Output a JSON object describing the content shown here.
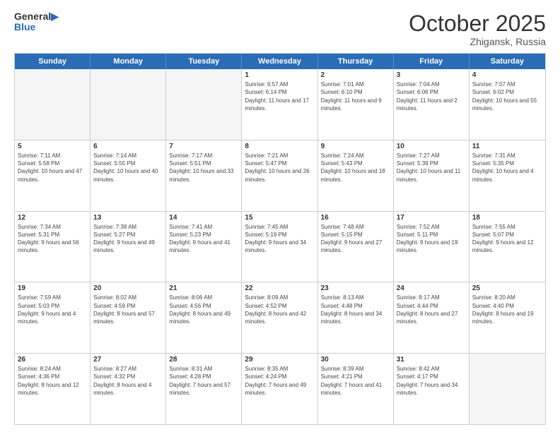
{
  "header": {
    "logo_line1": "General",
    "logo_line2": "Blue",
    "month": "October 2025",
    "location": "Zhigansk, Russia"
  },
  "days": [
    "Sunday",
    "Monday",
    "Tuesday",
    "Wednesday",
    "Thursday",
    "Friday",
    "Saturday"
  ],
  "rows": [
    [
      {
        "date": "",
        "empty": true
      },
      {
        "date": "",
        "empty": true
      },
      {
        "date": "",
        "empty": true
      },
      {
        "date": "1",
        "sunrise": "6:57 AM",
        "sunset": "6:14 PM",
        "daylight": "11 hours and 17 minutes."
      },
      {
        "date": "2",
        "sunrise": "7:01 AM",
        "sunset": "6:10 PM",
        "daylight": "11 hours and 9 minutes."
      },
      {
        "date": "3",
        "sunrise": "7:04 AM",
        "sunset": "6:06 PM",
        "daylight": "11 hours and 2 minutes."
      },
      {
        "date": "4",
        "sunrise": "7:07 AM",
        "sunset": "6:02 PM",
        "daylight": "10 hours and 55 minutes."
      }
    ],
    [
      {
        "date": "5",
        "sunrise": "7:11 AM",
        "sunset": "5:58 PM",
        "daylight": "10 hours and 47 minutes."
      },
      {
        "date": "6",
        "sunrise": "7:14 AM",
        "sunset": "5:55 PM",
        "daylight": "10 hours and 40 minutes."
      },
      {
        "date": "7",
        "sunrise": "7:17 AM",
        "sunset": "5:51 PM",
        "daylight": "10 hours and 33 minutes."
      },
      {
        "date": "8",
        "sunrise": "7:21 AM",
        "sunset": "5:47 PM",
        "daylight": "10 hours and 26 minutes."
      },
      {
        "date": "9",
        "sunrise": "7:24 AM",
        "sunset": "5:43 PM",
        "daylight": "10 hours and 18 minutes."
      },
      {
        "date": "10",
        "sunrise": "7:27 AM",
        "sunset": "5:39 PM",
        "daylight": "10 hours and 11 minutes."
      },
      {
        "date": "11",
        "sunrise": "7:31 AM",
        "sunset": "5:35 PM",
        "daylight": "10 hours and 4 minutes."
      }
    ],
    [
      {
        "date": "12",
        "sunrise": "7:34 AM",
        "sunset": "5:31 PM",
        "daylight": "9 hours and 56 minutes."
      },
      {
        "date": "13",
        "sunrise": "7:38 AM",
        "sunset": "5:27 PM",
        "daylight": "9 hours and 49 minutes."
      },
      {
        "date": "14",
        "sunrise": "7:41 AM",
        "sunset": "5:23 PM",
        "daylight": "9 hours and 41 minutes."
      },
      {
        "date": "15",
        "sunrise": "7:45 AM",
        "sunset": "5:19 PM",
        "daylight": "9 hours and 34 minutes."
      },
      {
        "date": "16",
        "sunrise": "7:48 AM",
        "sunset": "5:15 PM",
        "daylight": "9 hours and 27 minutes."
      },
      {
        "date": "17",
        "sunrise": "7:52 AM",
        "sunset": "5:11 PM",
        "daylight": "9 hours and 19 minutes."
      },
      {
        "date": "18",
        "sunrise": "7:55 AM",
        "sunset": "5:07 PM",
        "daylight": "9 hours and 12 minutes."
      }
    ],
    [
      {
        "date": "19",
        "sunrise": "7:59 AM",
        "sunset": "5:03 PM",
        "daylight": "9 hours and 4 minutes."
      },
      {
        "date": "20",
        "sunrise": "8:02 AM",
        "sunset": "4:59 PM",
        "daylight": "8 hours and 57 minutes."
      },
      {
        "date": "21",
        "sunrise": "8:06 AM",
        "sunset": "4:56 PM",
        "daylight": "8 hours and 49 minutes."
      },
      {
        "date": "22",
        "sunrise": "8:09 AM",
        "sunset": "4:52 PM",
        "daylight": "8 hours and 42 minutes."
      },
      {
        "date": "23",
        "sunrise": "8:13 AM",
        "sunset": "4:48 PM",
        "daylight": "8 hours and 34 minutes."
      },
      {
        "date": "24",
        "sunrise": "8:17 AM",
        "sunset": "4:44 PM",
        "daylight": "8 hours and 27 minutes."
      },
      {
        "date": "25",
        "sunrise": "8:20 AM",
        "sunset": "4:40 PM",
        "daylight": "8 hours and 19 minutes."
      }
    ],
    [
      {
        "date": "26",
        "sunrise": "8:24 AM",
        "sunset": "4:36 PM",
        "daylight": "8 hours and 12 minutes."
      },
      {
        "date": "27",
        "sunrise": "8:27 AM",
        "sunset": "4:32 PM",
        "daylight": "8 hours and 4 minutes."
      },
      {
        "date": "28",
        "sunrise": "8:31 AM",
        "sunset": "4:28 PM",
        "daylight": "7 hours and 57 minutes."
      },
      {
        "date": "29",
        "sunrise": "8:35 AM",
        "sunset": "4:24 PM",
        "daylight": "7 hours and 49 minutes."
      },
      {
        "date": "30",
        "sunrise": "8:39 AM",
        "sunset": "4:21 PM",
        "daylight": "7 hours and 41 minutes."
      },
      {
        "date": "31",
        "sunrise": "8:42 AM",
        "sunset": "4:17 PM",
        "daylight": "7 hours and 34 minutes."
      },
      {
        "date": "",
        "empty": true
      }
    ]
  ]
}
